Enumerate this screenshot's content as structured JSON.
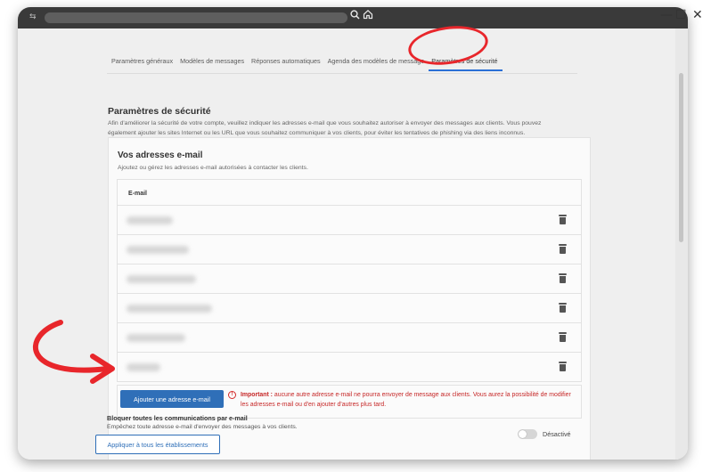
{
  "browser": {
    "favicon_glyph": "⇆",
    "search_icon": "magnifier-icon",
    "home_icon": "home-icon",
    "window_controls": [
      "—",
      "☐",
      "✕"
    ]
  },
  "tabs": [
    {
      "label": "Paramètres généraux",
      "active": false
    },
    {
      "label": "Modèles de messages",
      "active": false
    },
    {
      "label": "Réponses automatiques",
      "active": false
    },
    {
      "label": "Agenda des modèles de message",
      "active": false
    },
    {
      "label": "Paramètres de sécurité",
      "active": true
    }
  ],
  "security": {
    "title": "Paramètres de sécurité",
    "description": "Afin d'améliorer la sécurité de votre compte, veuillez indiquer les adresses e-mail que vous souhaitez autoriser à envoyer des messages aux clients. Vous pouvez également ajouter les sites Internet ou les URL que vous souhaitez communiquer à vos clients, pour éviter les tentatives de phishing via des liens inconnus."
  },
  "emails_card": {
    "title": "Vos adresses e-mail",
    "subtitle": "Ajoutez ou gérez les adresses e-mail autorisées à contacter les clients.",
    "column_header": "E-mail",
    "row_count": 6,
    "add_button": "Ajouter une adresse e-mail",
    "warning_strong": "Important :",
    "warning_text": "aucune autre adresse e-mail ne pourra envoyer de message aux clients. Vous aurez la possibilité de modifier les adresses e-mail ou d'en ajouter d'autres plus tard."
  },
  "block_emails": {
    "title": "Bloquer toutes les communications par e-mail",
    "description": "Empêchez toute adresse e-mail d'envoyer des messages à vos clients.",
    "apply_button": "Appliquer à tous les établissements",
    "toggle_label": "Désactivé",
    "toggle_on": false
  },
  "colors": {
    "accent": "#2f6fb8",
    "warning": "#c62828",
    "annotation": "#e8262b"
  }
}
